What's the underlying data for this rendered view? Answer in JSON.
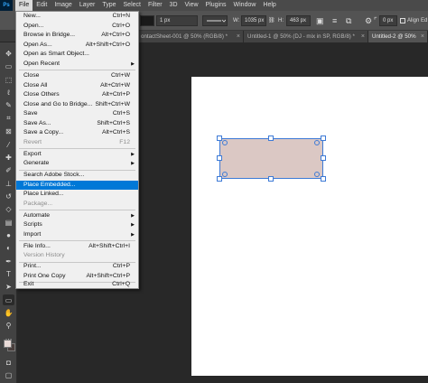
{
  "menubar": {
    "logo": "Ps",
    "items": [
      "File",
      "Edit",
      "Image",
      "Layer",
      "Type",
      "Select",
      "Filter",
      "3D",
      "View",
      "Plugins",
      "Window",
      "Help"
    ]
  },
  "options": {
    "stroke_size": "1 px",
    "w_label": "W:",
    "w_value": "1035 px",
    "h_label": "H:",
    "h_value": "463 px",
    "corner_value": "0 px",
    "align_edges": "Align Ed"
  },
  "tabs": [
    {
      "label": "ontactSheet-001 @ 50% (RGB/8) *"
    },
    {
      "label": "Untitled-1 @ 50% (DJ - mix in SP, RGB/8) *"
    },
    {
      "label": "Untitled-2 @ 50%"
    }
  ],
  "file_menu": [
    {
      "label": "New...",
      "shortcut": "Ctrl+N"
    },
    {
      "label": "Open...",
      "shortcut": "Ctrl+O"
    },
    {
      "label": "Browse in Bridge...",
      "shortcut": "Alt+Ctrl+O"
    },
    {
      "label": "Open As...",
      "shortcut": "Alt+Shift+Ctrl+O"
    },
    {
      "label": "Open as Smart Object..."
    },
    {
      "label": "Open Recent",
      "submenu": true
    },
    {
      "label": "Close",
      "shortcut": "Ctrl+W"
    },
    {
      "label": "Close All",
      "shortcut": "Alt+Ctrl+W"
    },
    {
      "label": "Close Others",
      "shortcut": "Alt+Ctrl+P"
    },
    {
      "label": "Close and Go to Bridge...",
      "shortcut": "Shift+Ctrl+W"
    },
    {
      "label": "Save",
      "shortcut": "Ctrl+S"
    },
    {
      "label": "Save As...",
      "shortcut": "Shift+Ctrl+S"
    },
    {
      "label": "Save a Copy...",
      "shortcut": "Alt+Ctrl+S"
    },
    {
      "label": "Revert",
      "shortcut": "F12",
      "disabled": true
    },
    {
      "label": "Export",
      "submenu": true
    },
    {
      "label": "Generate",
      "submenu": true
    },
    {
      "label": "Search Adobe Stock..."
    },
    {
      "label": "Place Embedded...",
      "selected": true
    },
    {
      "label": "Place Linked..."
    },
    {
      "label": "Package...",
      "disabled": true
    },
    {
      "label": "Automate",
      "submenu": true
    },
    {
      "label": "Scripts",
      "submenu": true
    },
    {
      "label": "Import",
      "submenu": true
    },
    {
      "label": "File Info...",
      "shortcut": "Alt+Shift+Ctrl+I"
    },
    {
      "label": "Version History",
      "disabled": true
    },
    {
      "label": "Print...",
      "shortcut": "Ctrl+P"
    },
    {
      "label": "Print One Copy",
      "shortcut": "Alt+Shift+Ctrl+P"
    },
    {
      "label": "Exit",
      "shortcut": "Ctrl+Q"
    }
  ],
  "colors": {
    "shape_fill": "#dbc8c4",
    "selection": "#3d7ad6",
    "menu_highlight": "#0078d7"
  }
}
